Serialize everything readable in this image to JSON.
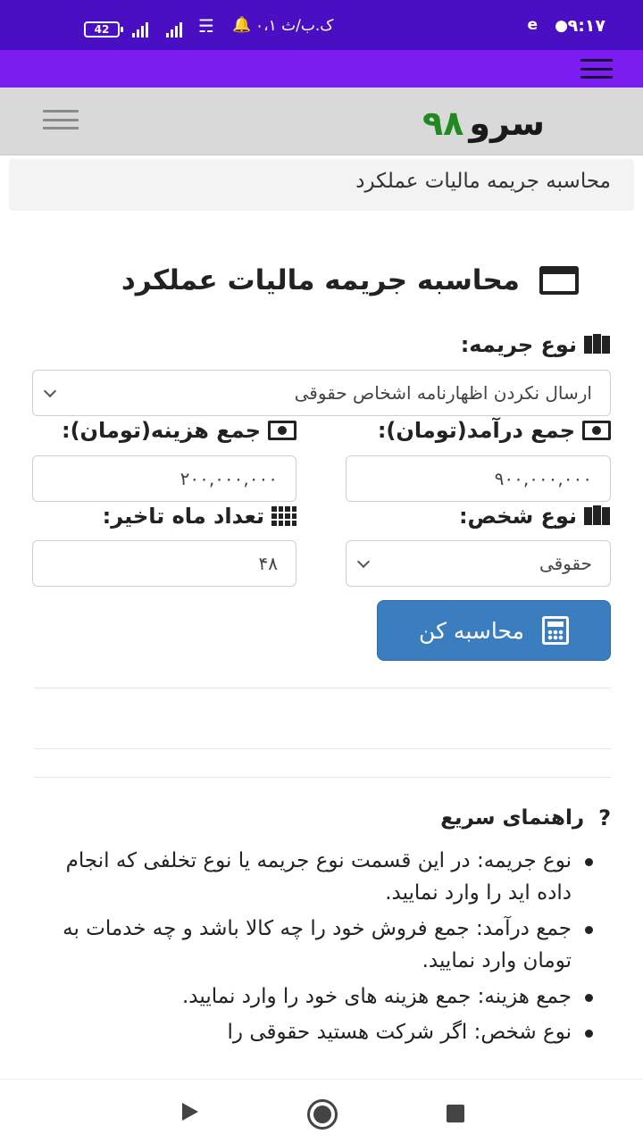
{
  "status_bar": {
    "time": "۹:۱۷",
    "carrier": "۰،۱ ک.ب/ث",
    "battery": "42"
  },
  "site": {
    "logo_word": "سرو",
    "logo_number": "۹۸"
  },
  "breadcrumb": "محاسبه جریمه مالیات عملکرد",
  "page_title": "محاسبه جریمه مالیات عملکرد",
  "form": {
    "penalty_type_label": "نوع جریمه:",
    "penalty_type_value": "ارسال نکردن اظهارنامه اشخاص حقوقی",
    "income_label": "جمع درآمد(تومان):",
    "income_value": "۹۰۰,۰۰۰,۰۰۰",
    "cost_label": "جمع هزینه(تومان):",
    "cost_value": "۲۰۰,۰۰۰,۰۰۰",
    "person_type_label": "نوع شخص:",
    "person_type_value": "حقوقی",
    "delay_months_label": "تعداد ماه تاخیر:",
    "delay_months_value": "۴۸",
    "submit_label": "محاسبه کن"
  },
  "guide": {
    "title": "راهنمای سریع",
    "icon": "?",
    "items": [
      "نوع جریمه: در این قسمت نوع جریمه یا نوع تخلفی که انجام داده اید را وارد نمایید.",
      "جمع درآمد: جمع فروش خود را چه کالا باشد و چه خدمات به تومان وارد نمایید.",
      "جمع هزینه: جمع هزینه های خود را وارد نمایید.",
      "نوع شخص: اگر شرکت هستید حقوقی را"
    ]
  },
  "icons": [
    "map-icon",
    "money-icon",
    "grid-icon",
    "calculator-icon",
    "window-icon",
    "question-icon",
    "menu-icon"
  ],
  "colors": {
    "status_bar": "#4a0fc3",
    "app_bar": "#7b1cf1",
    "button": "#3a7ebf",
    "logo_number": "#1f8a1f"
  }
}
